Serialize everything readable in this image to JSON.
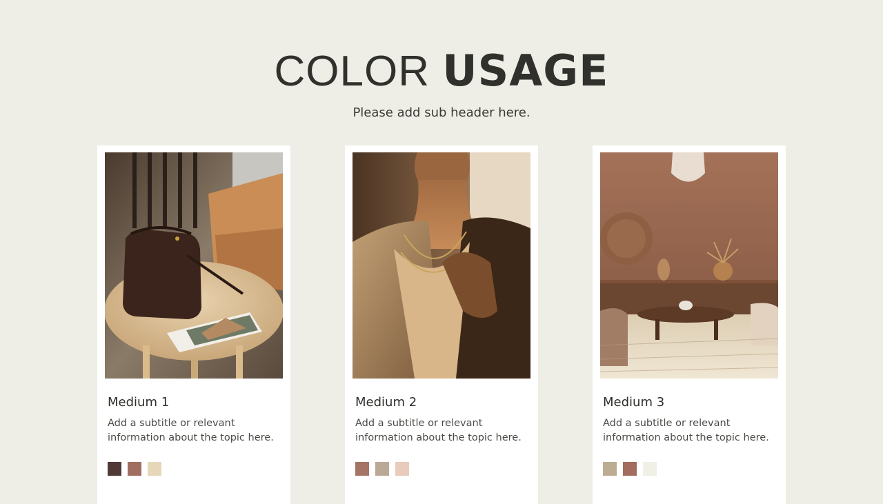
{
  "header": {
    "title_light": "COLOR ",
    "title_bold": "USAGE",
    "subheader": "Please add sub header here."
  },
  "cards": [
    {
      "title": "Medium 1",
      "subtitle": "Add a subtitle or relevant information about the topic here.",
      "image": "leather-bag-on-table-photo",
      "swatches": [
        "#4f3a38",
        "#a06e5f",
        "#e7d7b9"
      ]
    },
    {
      "title": "Medium 2",
      "subtitle": "Add a subtitle or relevant information about the topic here.",
      "image": "woman-in-blazer-photo",
      "swatches": [
        "#a57465",
        "#baa995",
        "#e9cbbb"
      ]
    },
    {
      "title": "Medium 3",
      "subtitle": "Add a subtitle or relevant information about the topic here.",
      "image": "earthy-interior-photo",
      "swatches": [
        "#bcac92",
        "#a36c5f",
        "#f1f0e6"
      ]
    }
  ],
  "colors": {
    "background": "#eeeee7",
    "card": "#ffffff",
    "text": "#333330"
  }
}
